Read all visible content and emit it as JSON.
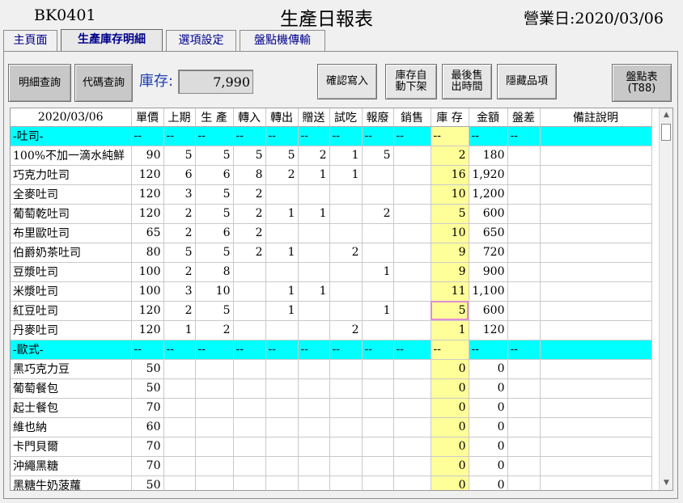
{
  "header": {
    "code": "BK0401",
    "title": "生產日報表",
    "business_date": "營業日:2020/03/06"
  },
  "tabs": [
    {
      "label": "主頁面"
    },
    {
      "label": "生產庫存明細"
    },
    {
      "label": "選項設定"
    },
    {
      "label": "盤點機傳輸"
    }
  ],
  "toolbar": {
    "detail_query": "明細查詢",
    "code_query": "代碼查詢",
    "stock_label": "庫存:",
    "stock_value": "7,990",
    "confirm_write": "確認寫入",
    "auto_delist_1": "庫存自",
    "auto_delist_2": "動下架",
    "last_sale_1": "最後售",
    "last_sale_2": "出時間",
    "hide_items": "隱藏品項",
    "inventory_1": "盤點表",
    "inventory_2": "(T88)"
  },
  "table": {
    "columns": [
      "2020/03/06",
      "單價",
      "上期",
      "生 產",
      "轉入",
      "轉出",
      "贈送",
      "試吃",
      "報廢",
      "銷售",
      "庫 存",
      "金額",
      "盤差",
      "備註說明"
    ],
    "rows": [
      {
        "type": "group",
        "cells": [
          "-吐司-",
          "--",
          "--",
          "--",
          "--",
          "--",
          "--",
          "--",
          "--",
          "--",
          "--",
          "--",
          "--",
          ""
        ]
      },
      {
        "type": "item",
        "cells": [
          "100%不加一滴水純鮮",
          "90",
          "5",
          "5",
          "5",
          "5",
          "2",
          "1",
          "5",
          "",
          "2",
          "180",
          "",
          ""
        ]
      },
      {
        "type": "item",
        "cells": [
          "巧克力吐司",
          "120",
          "6",
          "6",
          "8",
          "2",
          "1",
          "1",
          "",
          "",
          "16",
          "1,920",
          "",
          ""
        ]
      },
      {
        "type": "item",
        "cells": [
          "全麥吐司",
          "120",
          "3",
          "5",
          "2",
          "",
          "",
          "",
          "",
          "",
          "10",
          "1,200",
          "",
          ""
        ]
      },
      {
        "type": "item",
        "cells": [
          "葡萄乾吐司",
          "120",
          "2",
          "5",
          "2",
          "1",
          "1",
          "",
          "2",
          "",
          "5",
          "600",
          "",
          ""
        ]
      },
      {
        "type": "item",
        "cells": [
          "布里歐吐司",
          "65",
          "2",
          "6",
          "2",
          "",
          "",
          "",
          "",
          "",
          "10",
          "650",
          "",
          ""
        ]
      },
      {
        "type": "item",
        "cells": [
          "伯爵奶茶吐司",
          "80",
          "5",
          "5",
          "2",
          "1",
          "",
          "2",
          "",
          "",
          "9",
          "720",
          "",
          ""
        ]
      },
      {
        "type": "item",
        "cells": [
          "豆漿吐司",
          "100",
          "2",
          "8",
          "",
          "",
          "",
          "",
          "1",
          "",
          "9",
          "900",
          "",
          ""
        ]
      },
      {
        "type": "item",
        "cells": [
          "米漿吐司",
          "100",
          "3",
          "10",
          "",
          "1",
          "1",
          "",
          "",
          "",
          "11",
          "1,100",
          "",
          ""
        ]
      },
      {
        "type": "item",
        "selected": true,
        "cells": [
          "紅豆吐司",
          "120",
          "2",
          "5",
          "",
          "1",
          "",
          "",
          "1",
          "",
          "5",
          "600",
          "",
          ""
        ]
      },
      {
        "type": "item",
        "cells": [
          "丹麥吐司",
          "120",
          "1",
          "2",
          "",
          "",
          "",
          "2",
          "",
          "",
          "1",
          "120",
          "",
          ""
        ]
      },
      {
        "type": "group",
        "cells": [
          "-歐式-",
          "--",
          "--",
          "--",
          "--",
          "--",
          "--",
          "--",
          "--",
          "--",
          "--",
          "--",
          "--",
          ""
        ]
      },
      {
        "type": "item",
        "cells": [
          "黑巧克力豆",
          "50",
          "",
          "",
          "",
          "",
          "",
          "",
          "",
          "",
          "0",
          "0",
          "",
          ""
        ]
      },
      {
        "type": "item",
        "cells": [
          "葡萄餐包",
          "50",
          "",
          "",
          "",
          "",
          "",
          "",
          "",
          "",
          "0",
          "0",
          "",
          ""
        ]
      },
      {
        "type": "item",
        "cells": [
          "起士餐包",
          "70",
          "",
          "",
          "",
          "",
          "",
          "",
          "",
          "",
          "0",
          "0",
          "",
          ""
        ]
      },
      {
        "type": "item",
        "cells": [
          "維也納",
          "60",
          "",
          "",
          "",
          "",
          "",
          "",
          "",
          "",
          "0",
          "0",
          "",
          ""
        ]
      },
      {
        "type": "item",
        "cells": [
          "卡門貝爾",
          "70",
          "",
          "",
          "",
          "",
          "",
          "",
          "",
          "",
          "0",
          "0",
          "",
          ""
        ]
      },
      {
        "type": "item",
        "cells": [
          "沖繩黑糖",
          "70",
          "",
          "",
          "",
          "",
          "",
          "",
          "",
          "",
          "0",
          "0",
          "",
          ""
        ]
      },
      {
        "type": "item",
        "cells": [
          "黑糖牛奶菠蘿",
          "50",
          "",
          "",
          "",
          "",
          "",
          "",
          "",
          "",
          "0",
          "0",
          "",
          ""
        ]
      }
    ]
  },
  "scrollbar": {
    "up_icon": "▲",
    "down_icon": "▼"
  },
  "colors": {
    "group_row": "#00ffff",
    "stock_column": "#ffff99",
    "selection": "#e08cd8"
  }
}
